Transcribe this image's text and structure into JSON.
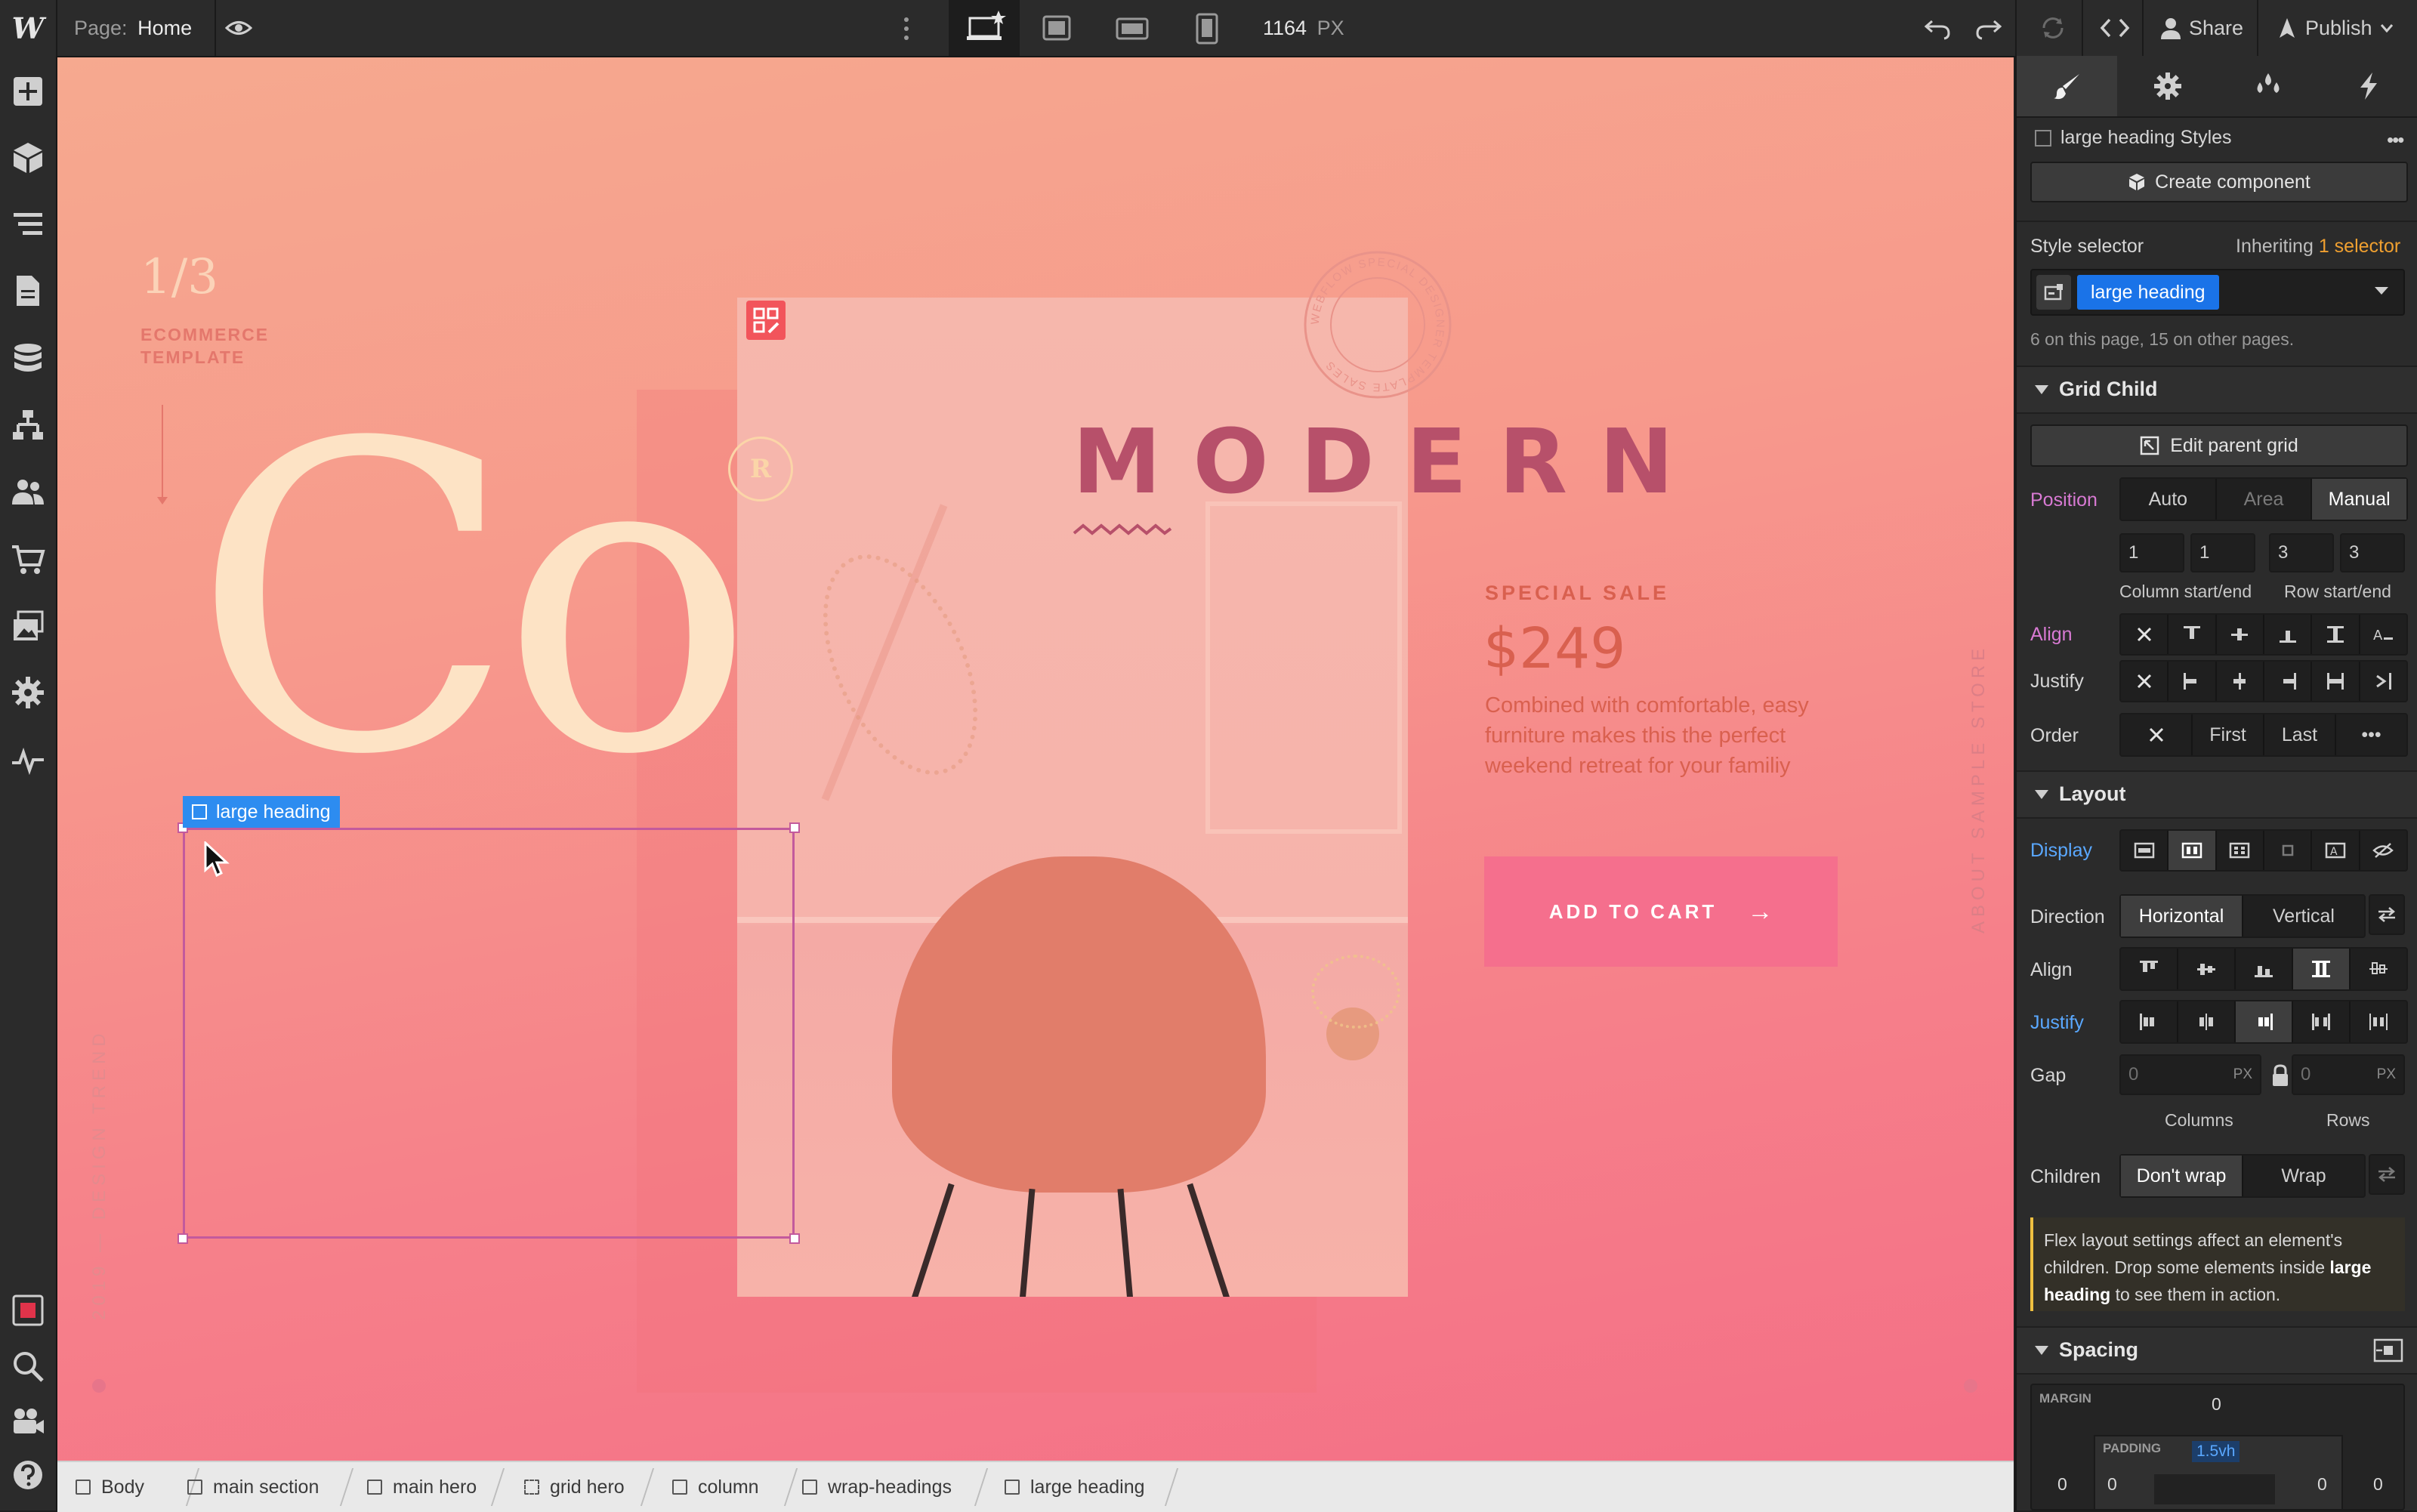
{
  "topbar": {
    "logo": "W",
    "page_label": "Page:",
    "page_name": "Home",
    "width_value": "1164",
    "width_unit": "PX",
    "share_label": "Share",
    "publish_label": "Publish"
  },
  "leftbar": {
    "icons": [
      "add-icon",
      "components-icon",
      "navigator-icon",
      "pages-icon",
      "cms-icon",
      "logic-icon",
      "users-icon",
      "ecommerce-icon",
      "assets-icon",
      "settings-icon",
      "audit-icon",
      "record-icon",
      "search-icon",
      "video-icon",
      "help-icon"
    ]
  },
  "canvas": {
    "counter": "1/3",
    "template_label_1": "ECOMMERCE",
    "template_label_2": "TEMPLATE",
    "big_letters": "Co",
    "logo_letter": "R",
    "heading": "MODERN",
    "stamp_text": "WEBFLOW SPECIAL DESIGNER TEMPLATE SALES",
    "sale_label": "SPECIAL SALE",
    "price": "$249",
    "description": "Combined with comfortable, easy furniture makes this the perfect weekend retreat for your familiy",
    "cta_label": "ADD TO CART",
    "cta_arrow": "→",
    "side_text_right": "ABOUT SAMPLE STORE",
    "side_text_left": "2019 — DESIGN TREND",
    "selected_element_label": "large heading"
  },
  "breadcrumb": {
    "items": [
      "Body",
      "main section",
      "main hero",
      "grid hero",
      "column",
      "wrap-headings",
      "large heading"
    ]
  },
  "panel": {
    "tabs": [
      "style-brush-icon",
      "settings-gear-icon",
      "interactions-drops-icon",
      "lightning-icon"
    ],
    "styles_title": "large heading Styles",
    "create_component": "Create component",
    "style_selector_label": "Style selector",
    "inheriting_label": "Inheriting",
    "inheriting_count": "1 selector",
    "selector_chip": "large heading",
    "selector_info": "6 on this page, 15 on other pages.",
    "grid_child": {
      "title": "Grid Child",
      "edit_parent": "Edit parent grid",
      "position_label": "Position",
      "position_options": [
        "Auto",
        "Area",
        "Manual"
      ],
      "position_values": [
        "1",
        "1",
        "3",
        "3"
      ],
      "column_caption": "Column start/end",
      "row_caption": "Row start/end",
      "align_label": "Align",
      "justify_label": "Justify",
      "order_label": "Order",
      "order_options": [
        "First",
        "Last",
        "•••"
      ]
    },
    "layout": {
      "title": "Layout",
      "display_label": "Display",
      "direction_label": "Direction",
      "direction_options": [
        "Horizontal",
        "Vertical"
      ],
      "align_label": "Align",
      "justify_label": "Justify",
      "gap_label": "Gap",
      "gap_col_value": "0",
      "gap_row_value": "0",
      "gap_unit": "PX",
      "gap_columns": "Columns",
      "gap_rows": "Rows",
      "children_label": "Children",
      "children_options": [
        "Don't wrap",
        "Wrap"
      ],
      "note_text_1": "Flex layout settings affect an element's children. Drop some elements inside",
      "note_bold": "large heading",
      "note_text_2": "to see them in action."
    },
    "spacing": {
      "title": "Spacing",
      "margin_label": "MARGIN",
      "margin_top": "0",
      "margin_left": "0",
      "margin_right": "0",
      "padding_label": "PADDING",
      "padding_top": "1.5vh",
      "padding_left": "0",
      "padding_right": "0"
    }
  },
  "colors": {
    "accent_blue": "#1a73e8",
    "selection_blue": "#2d8cf0",
    "cta_pink": "#f56f8d",
    "heading_color": "#b7506a",
    "cream": "#fde3c5",
    "inherit_orange": "#f0a030"
  }
}
